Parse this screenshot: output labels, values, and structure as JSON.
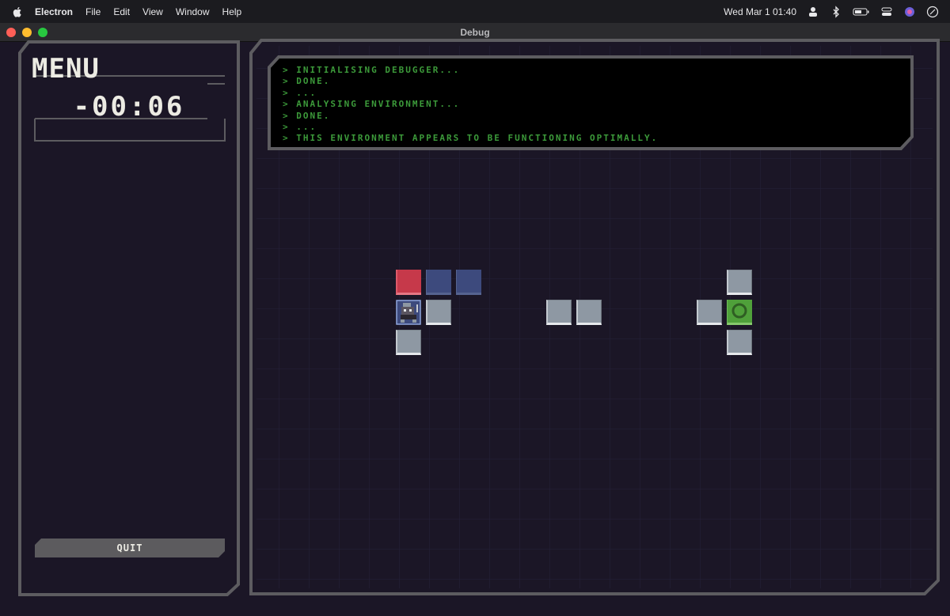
{
  "menubar": {
    "app_name": "Electron",
    "items": [
      "File",
      "Edit",
      "View",
      "Window",
      "Help"
    ],
    "clock": "Wed Mar 1  01:40"
  },
  "window": {
    "title": "Debug",
    "traffic_colors": [
      "#ff5f57",
      "#febc2e",
      "#28c840"
    ]
  },
  "sidebar": {
    "title": "MENU",
    "timer": "-00:06",
    "quit_label": "QUIT"
  },
  "console": {
    "lines": [
      "> INITIALISING DEBUGGER...",
      "> DONE.",
      "> ...",
      "> ANALYSING ENVIRONMENT...",
      "> DONE.",
      "> ...",
      "> THIS ENVIRONMENT APPEARS TO BE FUNCTIONING OPTIMALLY."
    ],
    "text_color": "#3c9a3a"
  },
  "board": {
    "tiles": [
      {
        "type": "red",
        "col": 0,
        "row": 0
      },
      {
        "type": "blue",
        "col": 1,
        "row": 0
      },
      {
        "type": "blue",
        "col": 2,
        "row": 0
      },
      {
        "type": "grey",
        "col": 11,
        "row": 0
      },
      {
        "type": "player",
        "col": 0,
        "row": 1
      },
      {
        "type": "grey",
        "col": 1,
        "row": 1
      },
      {
        "type": "grey",
        "col": 5,
        "row": 1
      },
      {
        "type": "grey",
        "col": 6,
        "row": 1
      },
      {
        "type": "grey",
        "col": 10,
        "row": 1
      },
      {
        "type": "goal",
        "col": 11,
        "row": 1
      },
      {
        "type": "grey",
        "col": 0,
        "row": 2
      },
      {
        "type": "grey",
        "col": 11,
        "row": 2
      }
    ]
  },
  "colors": {
    "background": "#1b1626",
    "grid_line": "#26213a",
    "frame": "#5d5c60",
    "panel_text": "#ecebe3"
  }
}
